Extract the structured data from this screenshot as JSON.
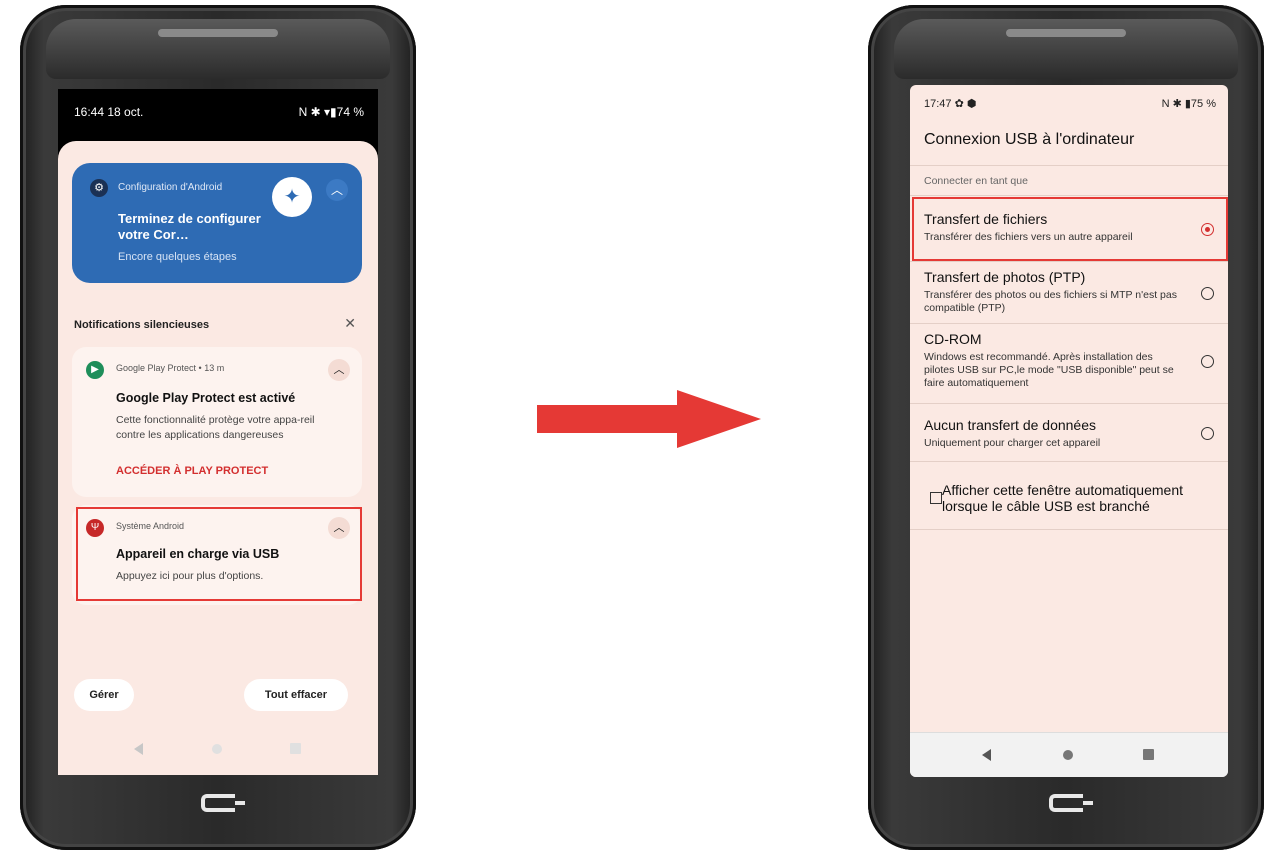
{
  "left_phone": {
    "status": {
      "time": "16:44 18 oct.",
      "icons": "N ✱ ▾▮74 %"
    },
    "setup_card": {
      "app": "Configuration d'Android",
      "title": "Terminez de configurer votre Cor…",
      "subtitle": "Encore quelques étapes"
    },
    "silent_header": "Notifications silencieuses",
    "play_protect": {
      "app": "Google Play Protect • 13 m",
      "title": "Google Play Protect est activé",
      "body": "Cette fonctionnalité protège votre appa-reil contre les applications dangereuses",
      "action": "ACCÉDER À PLAY PROTECT"
    },
    "usb_notif": {
      "app": "Système Android",
      "title": "Appareil en charge via USB",
      "body": "Appuyez ici pour plus d'options."
    },
    "buttons": {
      "manage": "Gérer",
      "clear_all": "Tout effacer"
    }
  },
  "right_phone": {
    "status": {
      "time": "17:47 ✿ ⬢",
      "icons": "N ✱ ▮75 %"
    },
    "title": "Connexion USB à l'ordinateur",
    "section": "Connecter en tant que",
    "options": [
      {
        "title": "Transfert de fichiers",
        "desc": "Transférer des fichiers vers un autre appareil",
        "selected": true
      },
      {
        "title": "Transfert de photos (PTP)",
        "desc": "Transférer des photos ou des fichiers si MTP n'est pas compatible (PTP)",
        "selected": false
      },
      {
        "title": "CD-ROM",
        "desc": "Windows est recommandé. Après installation des pilotes USB sur PC,le mode \"USB disponible\" peut se faire automatiquement",
        "selected": false
      },
      {
        "title": "Aucun transfert de données",
        "desc": "Uniquement pour charger cet appareil",
        "selected": false
      }
    ],
    "checkbox_label": "Afficher cette fenêtre automatiquement lorsque le câble USB est branché"
  },
  "colors": {
    "highlight": "#e53935",
    "accent_red": "#d32f2f",
    "setup_blue": "#2e6bb4",
    "shade_bg": "#fbe9e3",
    "arrow": "#e53935"
  }
}
